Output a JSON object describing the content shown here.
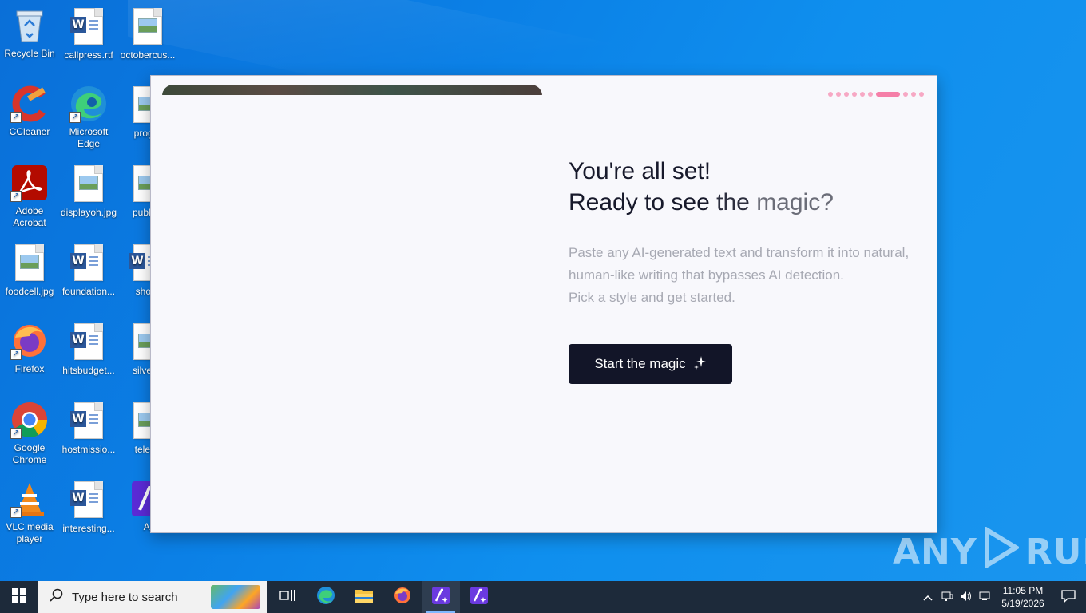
{
  "desktop": {
    "icons": [
      {
        "label": "Recycle Bin",
        "icon": "recycle-bin-icon"
      },
      {
        "label": "callpress.rtf",
        "icon": "word-document-icon"
      },
      {
        "label": "octobercus...",
        "icon": "image-file-icon"
      },
      {
        "label": "CCleaner",
        "icon": "ccleaner-icon"
      },
      {
        "label": "Microsoft Edge",
        "icon": "edge-icon"
      },
      {
        "label": "progra",
        "icon": "image-file-icon"
      },
      {
        "label": "Adobe Acrobat",
        "icon": "acrobat-icon"
      },
      {
        "label": "displayoh.jpg",
        "icon": "image-file-icon"
      },
      {
        "label": "publica",
        "icon": "image-file-icon"
      },
      {
        "label": "foodcell.jpg",
        "icon": "image-file-icon"
      },
      {
        "label": "foundation...",
        "icon": "word-document-icon"
      },
      {
        "label": "shortr",
        "icon": "word-document-icon"
      },
      {
        "label": "Firefox",
        "icon": "firefox-icon"
      },
      {
        "label": "hitsbudget...",
        "icon": "word-document-icon"
      },
      {
        "label": "silverm",
        "icon": "image-file-icon"
      },
      {
        "label": "Google Chrome",
        "icon": "chrome-icon"
      },
      {
        "label": "hostmissio...",
        "icon": "word-document-icon"
      },
      {
        "label": "teleph",
        "icon": "image-file-icon"
      },
      {
        "label": "VLC media player",
        "icon": "vlc-icon"
      },
      {
        "label": "interesting...",
        "icon": "word-document-icon"
      },
      {
        "label": "Ai",
        "icon": "ai-app-icon"
      }
    ]
  },
  "app": {
    "heading_line1": "You're all set!",
    "heading_line2_a": "Ready to see",
    "heading_line2_b": "the",
    "heading_line2_c": "magic?",
    "desc_line1": "Paste any AI-generated text and transform it into natural, human-like writing that bypasses AI detection.",
    "desc_line2": "Pick a style and get started.",
    "button_label": "Start the magic",
    "pager_active_index": 6,
    "pager_count": 10,
    "accent_color": "#f57fa8",
    "button_color": "#121528"
  },
  "watermark": {
    "text_left": "ANY",
    "text_right": "RUN"
  },
  "taskbar": {
    "search_placeholder": "Type here to search",
    "pinned": [
      "task-view-icon",
      "edge-icon",
      "file-explorer-icon",
      "firefox-icon",
      "ai-app-icon",
      "ai-app-icon"
    ],
    "time": "11:05 PM",
    "date": "5/19/2026"
  }
}
